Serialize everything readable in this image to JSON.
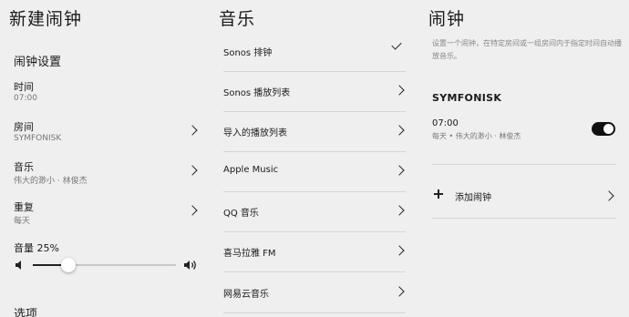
{
  "new_alarm_panel": {
    "title": "新建闹钟",
    "section_title": "闹钟设置",
    "rows": [
      {
        "label": "时间",
        "value": "07:00"
      },
      {
        "label": "房间",
        "value": "SYMFONISK"
      },
      {
        "label": "音乐",
        "value": "伟大的渺小 · 林俊杰"
      },
      {
        "label": "重复",
        "value": "每天"
      }
    ],
    "volume_label": "音量 25%",
    "volume_level": 0.25,
    "options_title": "选项"
  },
  "music_panel": {
    "title": "音乐",
    "items": [
      {
        "label": "Sonos 排钟",
        "selected": true
      },
      {
        "label": "Sonos 播放列表",
        "selected": false
      },
      {
        "label": "导入的播放列表",
        "selected": false
      },
      {
        "label": "Apple Music",
        "selected": false
      },
      {
        "label": "QQ 音乐",
        "selected": false
      },
      {
        "label": "喜马拉雅 FM",
        "selected": false
      },
      {
        "label": "网易云音乐",
        "selected": false
      }
    ]
  },
  "alarm_panel": {
    "title": "闹钟",
    "description": "设置一个闹钟，在特定房间或一组房间内于指定时间自动播放音乐。",
    "room": "SYMFONISK",
    "alarm": {
      "time": "07:00",
      "detail": "每天 • 伟大的渺小 · 林俊杰",
      "enabled": true
    },
    "add_label": "添加闹钟"
  }
}
